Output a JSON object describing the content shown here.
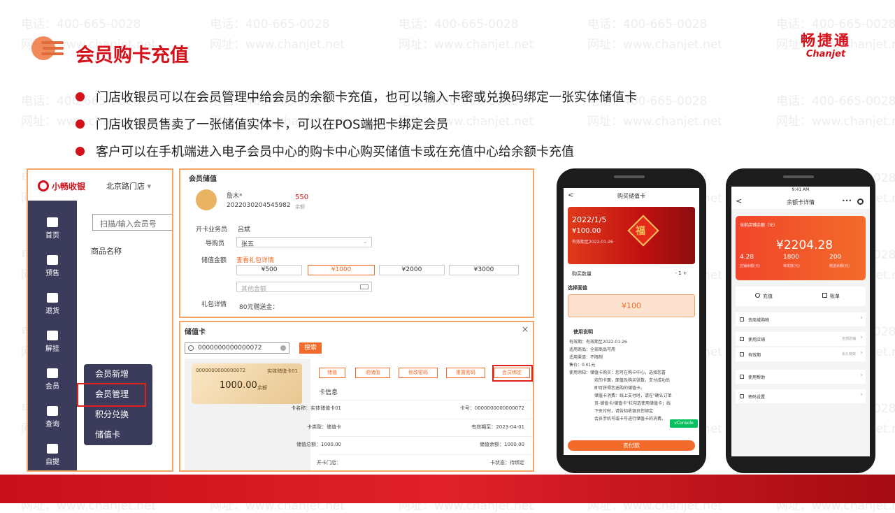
{
  "watermark": {
    "phone": "电话：400-665-0028",
    "site": "网址：www.chanjet.net"
  },
  "header": {
    "title": "会员购卡充值",
    "brand_cn": "畅捷通",
    "brand_en": "Chanjet"
  },
  "bullets": [
    "门店收银员可以在会员管理中给会员的余额卡充值，也可以输入卡密或兑换码绑定一张实体储值卡",
    "门店收银员售卖了一张储值实体卡，可以在POS端把卡绑定会员",
    "客户可以在手机端进入电子会员中心的购卡中心购买储值卡或在充值中心给余额卡充值"
  ],
  "pos": {
    "logo": "小畅收银",
    "store": "北京路门店",
    "search_placeholder": "扫描/输入会员号",
    "col_header": "商品名称",
    "sidebar": [
      "首页",
      "预售",
      "退货",
      "解挂",
      "会员",
      "查询",
      "自提"
    ],
    "submenu": [
      "会员新增",
      "会员管理",
      "积分兑换",
      "储值卡"
    ]
  },
  "recharge": {
    "header": "会员储值",
    "member_name": "詹木*",
    "member_no": "2022030204545982",
    "balance": "550",
    "balance_label": "余额",
    "clerk_label": "开卡业务员",
    "clerk": "吕斌",
    "guide_label": "导购员",
    "guide": "张五",
    "amount_label": "储值金额",
    "gift_link": "查看礼包详情",
    "amounts": [
      "¥500",
      "¥1000",
      "¥2000",
      "¥3000"
    ],
    "other_placeholder": "其他金额",
    "gift_label": "礼包详情",
    "gift_text": "80元赠送金："
  },
  "card": {
    "header": "储值卡",
    "close": "×",
    "search_value": "0000000000000072",
    "search_btn": "搜索",
    "card_no": "0000000000000072",
    "card_type": "实体储值卡01",
    "card_amount": "1000.00",
    "card_amount_unit": "余额",
    "actions": [
      "储值",
      "退储值",
      "修改密码",
      "重置密码",
      "会员绑定"
    ],
    "info_title": "卡信息",
    "info": [
      [
        "卡名称：实体储值卡01",
        "卡号：0000000000000072"
      ],
      [
        "卡类型：储值卡",
        "有效期至：2023-04-01"
      ],
      [
        "储值总额：1000.00",
        "储值余额：1000.00"
      ],
      [
        "开卡门店：",
        "卡状态：待绑定"
      ]
    ]
  },
  "phone1": {
    "title": "购买储值卡",
    "back": "<",
    "date": "2022/1/5",
    "price": "¥100.00",
    "expiry": "有效期至2022-01-26",
    "deco": "福",
    "qty_label": "购买数量",
    "qty": "1",
    "minus": "-",
    "plus": "+",
    "face_label": "选择面值",
    "face": "¥100",
    "notes_title": "使用说明",
    "notes": [
      "有效期：有效期至2022-01-26",
      "适用商品：全部商品可用",
      "适用渠道：不限制",
      "售价：0.01元",
      "使用须知：储值卡购买：您可在购卡中心，选择您喜",
      "欢的卡面，面值及购买张数，支付成功后",
      "即可获得您选购的储值卡。",
      "储值卡消费：线上支付时，请在\"确认订单",
      "页-储值卡/储值卡\"栏勾选使用储值卡；线",
      "下支付时，请告知收银员您绑定",
      "会员手机号或卡号进行储值卡的消费。"
    ],
    "console": "vConsole",
    "pay_btn": "去付款"
  },
  "phone2": {
    "time": "9:41 AM",
    "title": "余额卡详情",
    "balance_label": "当前店铺余额（元）",
    "balance": "¥2204.28",
    "stats": [
      [
        "4.28",
        "店铺余额(元)"
      ],
      [
        "1800",
        "待发放(元)"
      ],
      [
        "200",
        "赠送余额(元)"
      ]
    ],
    "recharge": "充值",
    "bill": "账单",
    "links": [
      [
        "去商城购物",
        ""
      ],
      [
        "使用店铺",
        "全部店铺"
      ],
      [
        "有效期",
        "永久有效"
      ],
      [
        "使用帮助",
        ""
      ],
      [
        "密码设置",
        ""
      ]
    ]
  },
  "colors": {
    "accent": "#d4101a",
    "sidebar": "#3b3c5c",
    "highlight": "#f3a66a",
    "orange": "#f36b2a"
  }
}
